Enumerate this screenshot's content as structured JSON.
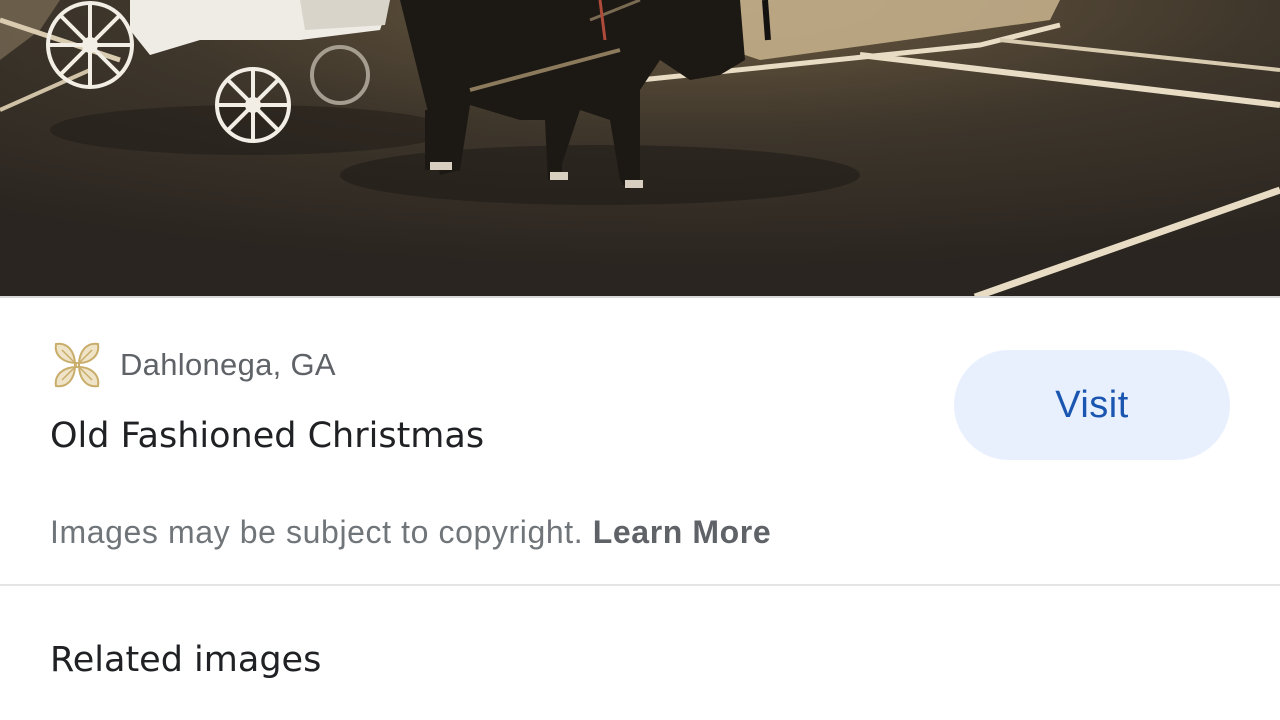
{
  "result": {
    "site_name": "Dahlonega, GA",
    "site_logo_icon": "four-leaf-ornament-icon",
    "title": "Old Fashioned Christmas",
    "visit_label": "Visit"
  },
  "notice": {
    "text": "Images may be subject to copyright.",
    "link_label": "Learn More"
  },
  "related": {
    "heading": "Related images"
  },
  "colors": {
    "visit_bg": "#e8f0fe",
    "visit_text": "#1a56b0",
    "logo_gold": "#d2b77a"
  }
}
